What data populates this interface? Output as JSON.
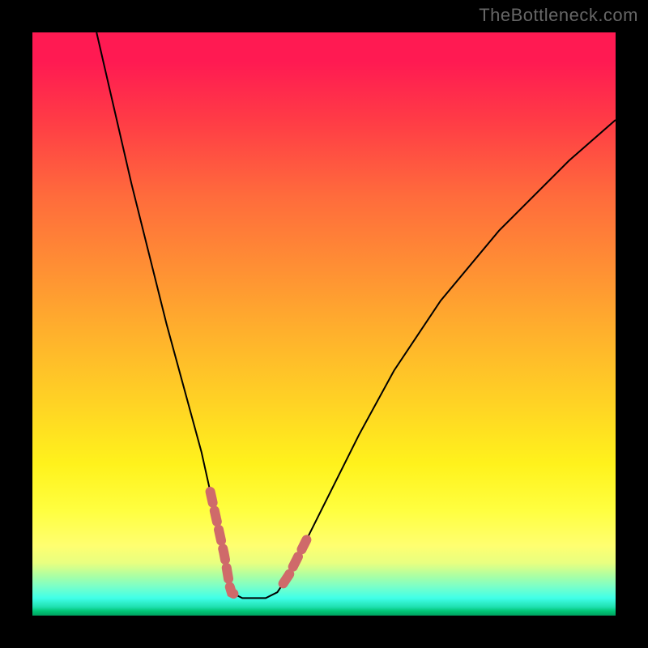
{
  "watermark": "TheBottleneck.com",
  "colors": {
    "highlight": "#cf6a6a",
    "curve": "#000000"
  },
  "chart_data": {
    "type": "line",
    "title": "",
    "xlabel": "",
    "ylabel": "",
    "xlim": [
      0,
      100
    ],
    "ylim": [
      0,
      100
    ],
    "note": "V-shaped bottleneck curve on rainbow gradient; y=100 at top (red/worst), y=0 at bottom (green/best). Minimum flat from x≈34 to x≈42 at y≈3. Highlighted dashed segments near the trough on both arms.",
    "series": [
      {
        "name": "bottleneck-curve",
        "x": [
          11,
          14,
          17,
          20,
          23,
          26,
          29,
          31,
          33,
          34,
          36,
          38,
          40,
          42,
          44,
          47,
          51,
          56,
          62,
          70,
          80,
          92,
          100
        ],
        "y": [
          100,
          87,
          74,
          62,
          50,
          39,
          28,
          19,
          10,
          4,
          3,
          3,
          3,
          4,
          7,
          13,
          21,
          31,
          42,
          54,
          66,
          78,
          85
        ]
      }
    ],
    "highlights": [
      {
        "name": "left-arm-highlight",
        "x_range": [
          30.5,
          34.5
        ]
      },
      {
        "name": "right-arm-highlight",
        "x_range": [
          43.0,
          47.0
        ]
      }
    ]
  }
}
